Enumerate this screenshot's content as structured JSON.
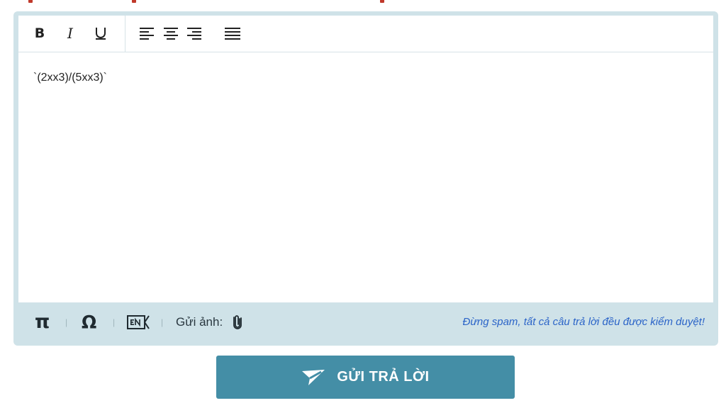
{
  "editor": {
    "toolbar": {
      "bold_label": "B",
      "italic_label": "I"
    },
    "content": "`(2xx3)/(5xx3)`",
    "footer": {
      "pi_label": "π",
      "omega_label": "Ω",
      "separator": "|",
      "photo_label": "Gửi ảnh:",
      "notice": "Đừng spam, tất cả câu trả lời đều được kiểm duyệt!"
    }
  },
  "submit": {
    "label": "GỬI TRẢ LỜI"
  },
  "colors": {
    "editor_frame": "#cfe2e8",
    "button_bg": "#448ea6",
    "notice_text": "#2b64c8"
  },
  "icons": [
    "underline-icon",
    "align-left-icon",
    "align-center-icon",
    "align-right-icon",
    "justify-icon",
    "en-keyboard-icon",
    "paperclip-icon",
    "paper-plane-icon"
  ]
}
